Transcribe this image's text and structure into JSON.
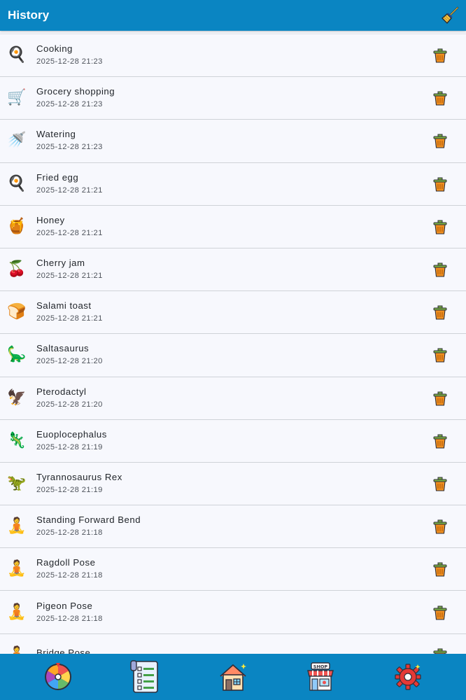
{
  "app_bar": {
    "title": "History",
    "clear_icon": "broom-icon"
  },
  "colors": {
    "primary": "#0a85c2",
    "list_background": "#f7f8fd",
    "divider": "#cfd2d8",
    "title_text": "#1f2328",
    "timestamp_text": "#4f545c"
  },
  "history": {
    "items": [
      {
        "title": "Cooking",
        "time": "2025-12-28 21:23",
        "icon": "cooking-pan-icon",
        "glyph": "🍳"
      },
      {
        "title": "Grocery shopping",
        "time": "2025-12-28 21:23",
        "icon": "shopping-cart-icon",
        "glyph": "🛒"
      },
      {
        "title": "Watering",
        "time": "2025-12-28 21:23",
        "icon": "watering-can-icon",
        "glyph": "🚿"
      },
      {
        "title": "Fried egg",
        "time": "2025-12-28 21:21",
        "icon": "fried-egg-icon",
        "glyph": "🍳"
      },
      {
        "title": "Honey",
        "time": "2025-12-28 21:21",
        "icon": "honey-jar-icon",
        "glyph": "🍯"
      },
      {
        "title": "Cherry jam",
        "time": "2025-12-28 21:21",
        "icon": "jam-jar-icon",
        "glyph": "🍒"
      },
      {
        "title": "Salami toast",
        "time": "2025-12-28 21:21",
        "icon": "toast-icon",
        "glyph": "🍞"
      },
      {
        "title": "Saltasaurus",
        "time": "2025-12-28 21:20",
        "icon": "sauropod-icon",
        "glyph": "🦕"
      },
      {
        "title": "Pterodactyl",
        "time": "2025-12-28 21:20",
        "icon": "pterodactyl-icon",
        "glyph": "🦅"
      },
      {
        "title": "Euoplocephalus",
        "time": "2025-12-28 21:19",
        "icon": "ankylosaur-icon",
        "glyph": "🦎"
      },
      {
        "title": "Tyrannosaurus Rex",
        "time": "2025-12-28 21:19",
        "icon": "t-rex-icon",
        "glyph": "🦖"
      },
      {
        "title": "Standing Forward Bend",
        "time": "2025-12-28 21:18",
        "icon": "yoga-pose-icon",
        "glyph": "🧘"
      },
      {
        "title": "Ragdoll Pose",
        "time": "2025-12-28 21:18",
        "icon": "yoga-pose-icon",
        "glyph": "🧘"
      },
      {
        "title": "Pigeon Pose",
        "time": "2025-12-28 21:18",
        "icon": "yoga-pose-icon",
        "glyph": "🧘"
      },
      {
        "title": "Bridge Pose",
        "time": "",
        "icon": "yoga-pose-icon",
        "glyph": "🧘"
      }
    ],
    "row_action_icon": "trash-bin-icon"
  },
  "bottom_nav": {
    "items": [
      {
        "name": "wheel",
        "icon": "prize-wheel-icon"
      },
      {
        "name": "tasks",
        "icon": "checklist-icon"
      },
      {
        "name": "home",
        "icon": "house-icon"
      },
      {
        "name": "shop",
        "icon": "shop-icon"
      },
      {
        "name": "settings",
        "icon": "gear-icon"
      }
    ]
  }
}
